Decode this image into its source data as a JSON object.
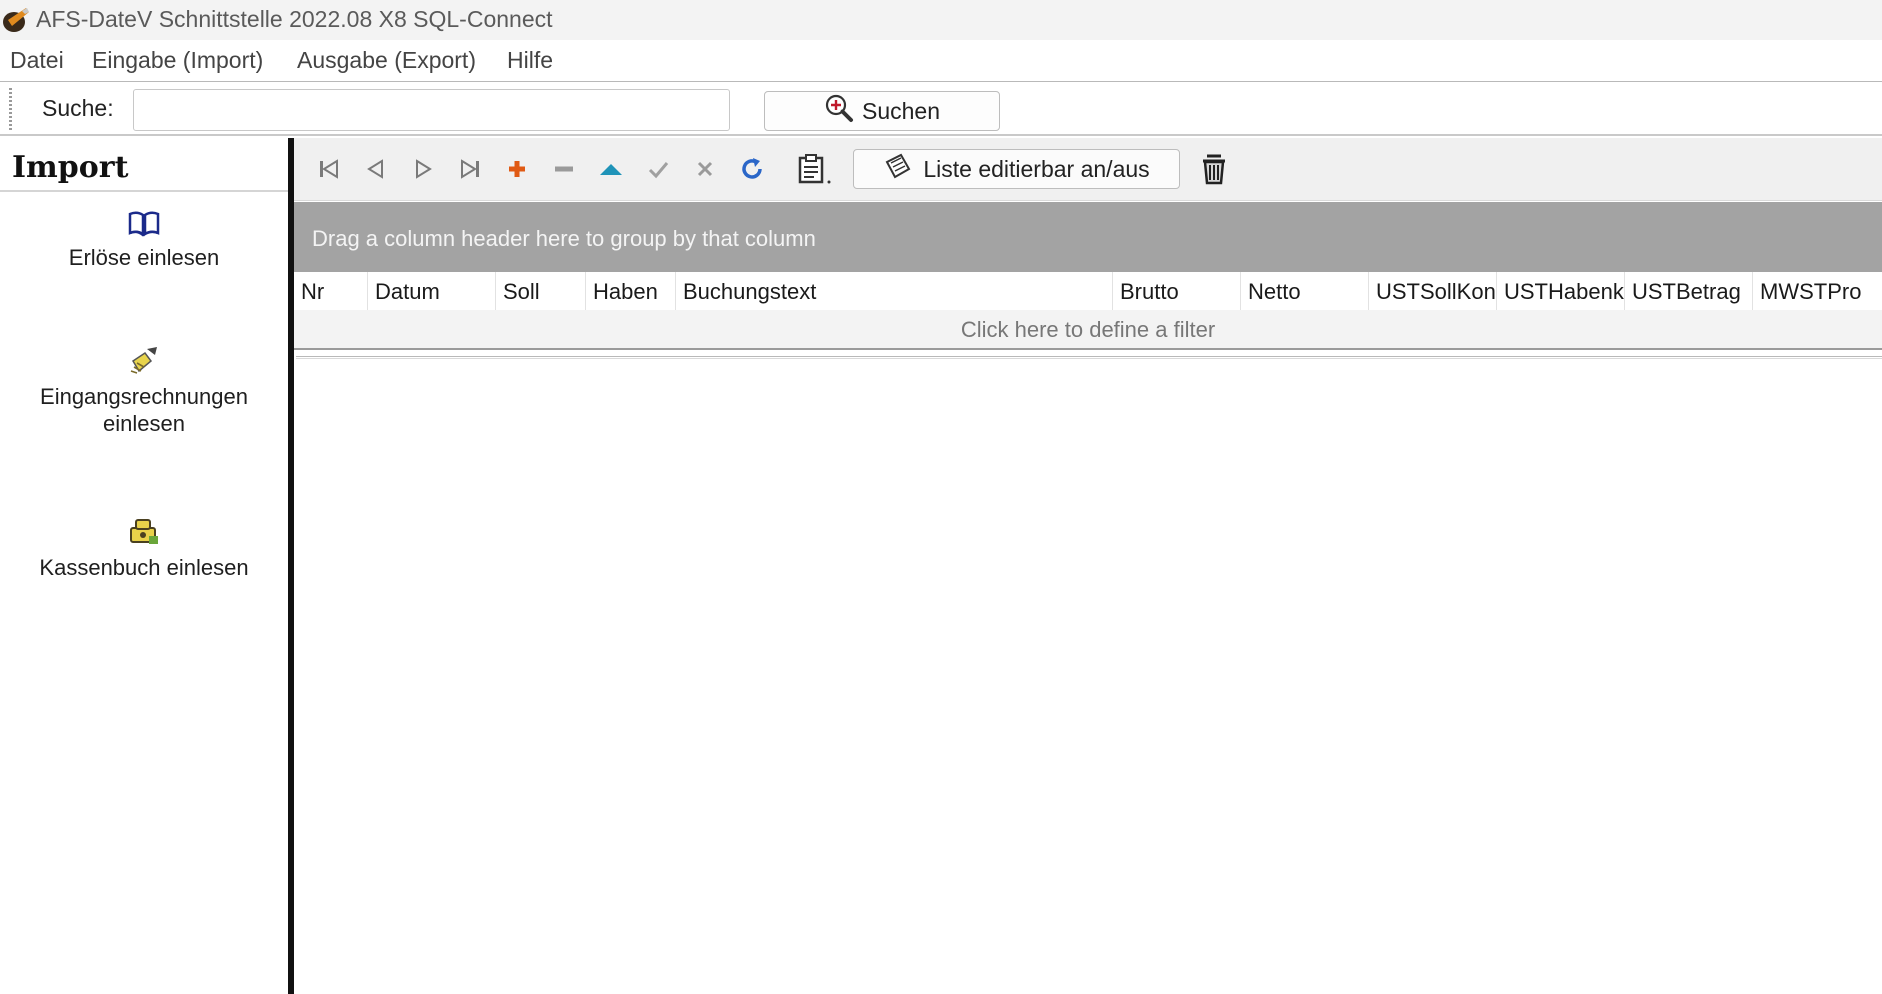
{
  "window": {
    "title": "AFS-DateV Schnittstelle 2022.08 X8 SQL-Connect"
  },
  "menu": {
    "items": [
      "Datei",
      "Eingabe (Import)",
      "Ausgabe (Export)",
      "Hilfe"
    ]
  },
  "search": {
    "label": "Suche:",
    "value": "",
    "button_label": "Suchen"
  },
  "sidebar": {
    "title": "Import",
    "items": [
      {
        "label": "Erlöse einlesen",
        "icon": "book-icon"
      },
      {
        "label": "Eingangsrechnungen einlesen",
        "icon": "broom-icon"
      },
      {
        "label": "Kassenbuch einlesen",
        "icon": "cashbox-icon"
      }
    ]
  },
  "toolbar": {
    "buttons": [
      "first-record",
      "prior-record",
      "next-record",
      "last-record",
      "insert-record",
      "delete-record",
      "edit-record",
      "post-record",
      "cancel-record",
      "refresh-records",
      "grid-settings"
    ],
    "edit_toggle_label": "Liste editierbar an/aus",
    "trash_icon": "trash-icon"
  },
  "grid": {
    "group_hint": "Drag a column header here to group by that column",
    "columns": [
      "Nr",
      "Datum",
      "Soll",
      "Haben",
      "Buchungstext",
      "Brutto",
      "Netto",
      "USTSollKon",
      "USTHabenk",
      "USTBetrag",
      "MWSTPro"
    ],
    "filter_hint": "Click here to define a filter",
    "rows": []
  },
  "colors": {
    "group_panel": "#a3a3a3",
    "splitter": "#111111",
    "accent_blue": "#2a5db0",
    "insert_orange": "#e05a14"
  }
}
